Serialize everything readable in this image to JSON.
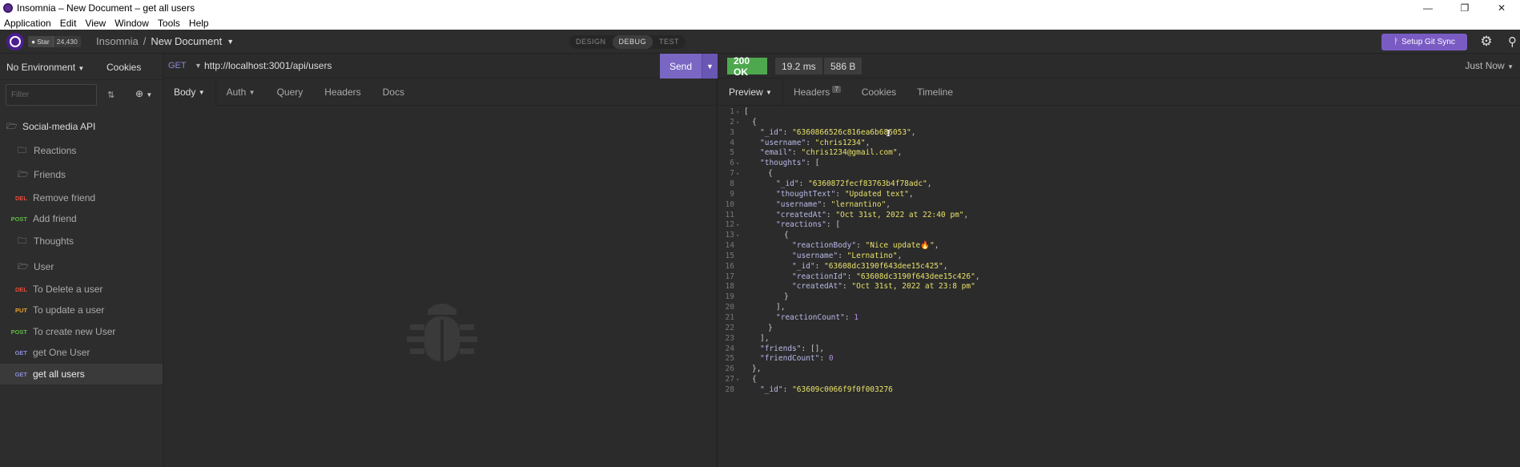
{
  "window": {
    "title": "Insomnia – New Document – get all users",
    "minimize_icon": "—",
    "maximize_icon": "❐",
    "close_icon": "✕"
  },
  "menu": [
    "Application",
    "Edit",
    "View",
    "Window",
    "Tools",
    "Help"
  ],
  "header": {
    "github_star_label": "Star",
    "github_star_count": "24,430",
    "breadcrumb_root": "Insomnia",
    "breadcrumb_separator": "/",
    "breadcrumb_doc": "New Document",
    "modes": [
      "DESIGN",
      "DEBUG",
      "TEST"
    ],
    "active_mode": "DEBUG",
    "git_sync_label": "Setup Git Sync"
  },
  "sidebar": {
    "environment": "No Environment",
    "cookies_label": "Cookies",
    "filter_placeholder": "Filter",
    "collection": "Social-media API",
    "items": [
      {
        "type": "folder",
        "label": "Reactions"
      },
      {
        "type": "folder",
        "label": "Friends"
      },
      {
        "type": "request",
        "method": "DEL",
        "label": "Remove friend"
      },
      {
        "type": "request",
        "method": "POST",
        "label": "Add friend"
      },
      {
        "type": "folder",
        "label": "Thoughts"
      },
      {
        "type": "folder",
        "label": "User"
      },
      {
        "type": "request",
        "method": "DEL",
        "label": "To Delete a user"
      },
      {
        "type": "request",
        "method": "PUT",
        "label": "To update a user"
      },
      {
        "type": "request",
        "method": "POST",
        "label": "To create new User"
      },
      {
        "type": "request",
        "method": "GET",
        "label": "get One User"
      },
      {
        "type": "request",
        "method": "GET",
        "label": "get all users"
      }
    ]
  },
  "request": {
    "method": "GET",
    "url": "http://localhost:3001/api/users",
    "send_label": "Send",
    "tabs": [
      "Body",
      "Auth",
      "Query",
      "Headers",
      "Docs"
    ]
  },
  "response": {
    "status": "200 OK",
    "time": "19.2 ms",
    "size": "586 B",
    "timestamp": "Just Now",
    "tabs": [
      "Preview",
      "Headers",
      "Cookies",
      "Timeline"
    ],
    "headers_count": "7",
    "lines": [
      {
        "n": "1",
        "indent": 0,
        "fold": true,
        "parts": [
          [
            "p",
            "["
          ]
        ]
      },
      {
        "n": "2",
        "indent": 1,
        "fold": true,
        "parts": [
          [
            "p",
            "{"
          ]
        ]
      },
      {
        "n": "3",
        "indent": 2,
        "fold": false,
        "parts": [
          [
            "k",
            "\"_id\""
          ],
          [
            "p",
            ": "
          ],
          [
            "str",
            "\"6360866526c816ea6b686053\""
          ],
          [
            "p",
            ","
          ]
        ]
      },
      {
        "n": "4",
        "indent": 2,
        "fold": false,
        "parts": [
          [
            "k",
            "\"username\""
          ],
          [
            "p",
            ": "
          ],
          [
            "str",
            "\"chris1234\""
          ],
          [
            "p",
            ","
          ]
        ]
      },
      {
        "n": "5",
        "indent": 2,
        "fold": false,
        "parts": [
          [
            "k",
            "\"email\""
          ],
          [
            "p",
            ": "
          ],
          [
            "str",
            "\"chris1234@gmail.com\""
          ],
          [
            "p",
            ","
          ]
        ]
      },
      {
        "n": "6",
        "indent": 2,
        "fold": true,
        "parts": [
          [
            "k",
            "\"thoughts\""
          ],
          [
            "p",
            ": ["
          ]
        ]
      },
      {
        "n": "7",
        "indent": 3,
        "fold": true,
        "parts": [
          [
            "p",
            "{"
          ]
        ]
      },
      {
        "n": "8",
        "indent": 4,
        "fold": false,
        "parts": [
          [
            "k",
            "\"_id\""
          ],
          [
            "p",
            ": "
          ],
          [
            "str",
            "\"6360872fecf83763b4f78adc\""
          ],
          [
            "p",
            ","
          ]
        ]
      },
      {
        "n": "9",
        "indent": 4,
        "fold": false,
        "parts": [
          [
            "k",
            "\"thoughtText\""
          ],
          [
            "p",
            ": "
          ],
          [
            "str",
            "\"Updated text\""
          ],
          [
            "p",
            ","
          ]
        ]
      },
      {
        "n": "10",
        "indent": 4,
        "fold": false,
        "parts": [
          [
            "k",
            "\"username\""
          ],
          [
            "p",
            ": "
          ],
          [
            "str",
            "\"lernantino\""
          ],
          [
            "p",
            ","
          ]
        ]
      },
      {
        "n": "11",
        "indent": 4,
        "fold": false,
        "parts": [
          [
            "k",
            "\"createdAt\""
          ],
          [
            "p",
            ": "
          ],
          [
            "str",
            "\"Oct 31st, 2022 at 22:40 pm\""
          ],
          [
            "p",
            ","
          ]
        ]
      },
      {
        "n": "12",
        "indent": 4,
        "fold": true,
        "parts": [
          [
            "k",
            "\"reactions\""
          ],
          [
            "p",
            ": ["
          ]
        ]
      },
      {
        "n": "13",
        "indent": 5,
        "fold": true,
        "parts": [
          [
            "p",
            "{"
          ]
        ]
      },
      {
        "n": "14",
        "indent": 6,
        "fold": false,
        "parts": [
          [
            "k",
            "\"reactionBody\""
          ],
          [
            "p",
            ": "
          ],
          [
            "str",
            "\"Nice update🔥\""
          ],
          [
            "p",
            ","
          ]
        ]
      },
      {
        "n": "15",
        "indent": 6,
        "fold": false,
        "parts": [
          [
            "k",
            "\"username\""
          ],
          [
            "p",
            ": "
          ],
          [
            "str",
            "\"Lernatino\""
          ],
          [
            "p",
            ","
          ]
        ]
      },
      {
        "n": "16",
        "indent": 6,
        "fold": false,
        "parts": [
          [
            "k",
            "\"_id\""
          ],
          [
            "p",
            ": "
          ],
          [
            "str",
            "\"63608dc3190f643dee15c425\""
          ],
          [
            "p",
            ","
          ]
        ]
      },
      {
        "n": "17",
        "indent": 6,
        "fold": false,
        "parts": [
          [
            "k",
            "\"reactionId\""
          ],
          [
            "p",
            ": "
          ],
          [
            "str",
            "\"63608dc3190f643dee15c426\""
          ],
          [
            "p",
            ","
          ]
        ]
      },
      {
        "n": "18",
        "indent": 6,
        "fold": false,
        "parts": [
          [
            "k",
            "\"createdAt\""
          ],
          [
            "p",
            ": "
          ],
          [
            "str",
            "\"Oct 31st, 2022 at 23:8 pm\""
          ]
        ]
      },
      {
        "n": "19",
        "indent": 5,
        "fold": false,
        "parts": [
          [
            "p",
            "}"
          ]
        ]
      },
      {
        "n": "20",
        "indent": 4,
        "fold": false,
        "parts": [
          [
            "p",
            "],"
          ]
        ]
      },
      {
        "n": "21",
        "indent": 4,
        "fold": false,
        "parts": [
          [
            "k",
            "\"reactionCount\""
          ],
          [
            "p",
            ": "
          ],
          [
            "num",
            "1"
          ]
        ]
      },
      {
        "n": "22",
        "indent": 3,
        "fold": false,
        "parts": [
          [
            "p",
            "}"
          ]
        ]
      },
      {
        "n": "23",
        "indent": 2,
        "fold": false,
        "parts": [
          [
            "p",
            "],"
          ]
        ]
      },
      {
        "n": "24",
        "indent": 2,
        "fold": false,
        "parts": [
          [
            "k",
            "\"friends\""
          ],
          [
            "p",
            ": [],"
          ]
        ]
      },
      {
        "n": "25",
        "indent": 2,
        "fold": false,
        "parts": [
          [
            "k",
            "\"friendCount\""
          ],
          [
            "p",
            ": "
          ],
          [
            "num",
            "0"
          ]
        ]
      },
      {
        "n": "26",
        "indent": 1,
        "fold": false,
        "parts": [
          [
            "p",
            "},"
          ]
        ]
      },
      {
        "n": "27",
        "indent": 1,
        "fold": true,
        "parts": [
          [
            "p",
            "{"
          ]
        ]
      },
      {
        "n": "28",
        "indent": 2,
        "fold": false,
        "parts": [
          [
            "k",
            "\"_id\""
          ],
          [
            "p",
            ": "
          ],
          [
            "str",
            "\"63609c0066f9f0f003276"
          ]
        ]
      }
    ]
  },
  "colors": {
    "accent": "#7a67c4",
    "status_ok": "#4ea84e",
    "method_get": "#8a8ad8",
    "method_post": "#5fb845",
    "method_put": "#e8a12a",
    "method_del": "#e74c3c"
  }
}
